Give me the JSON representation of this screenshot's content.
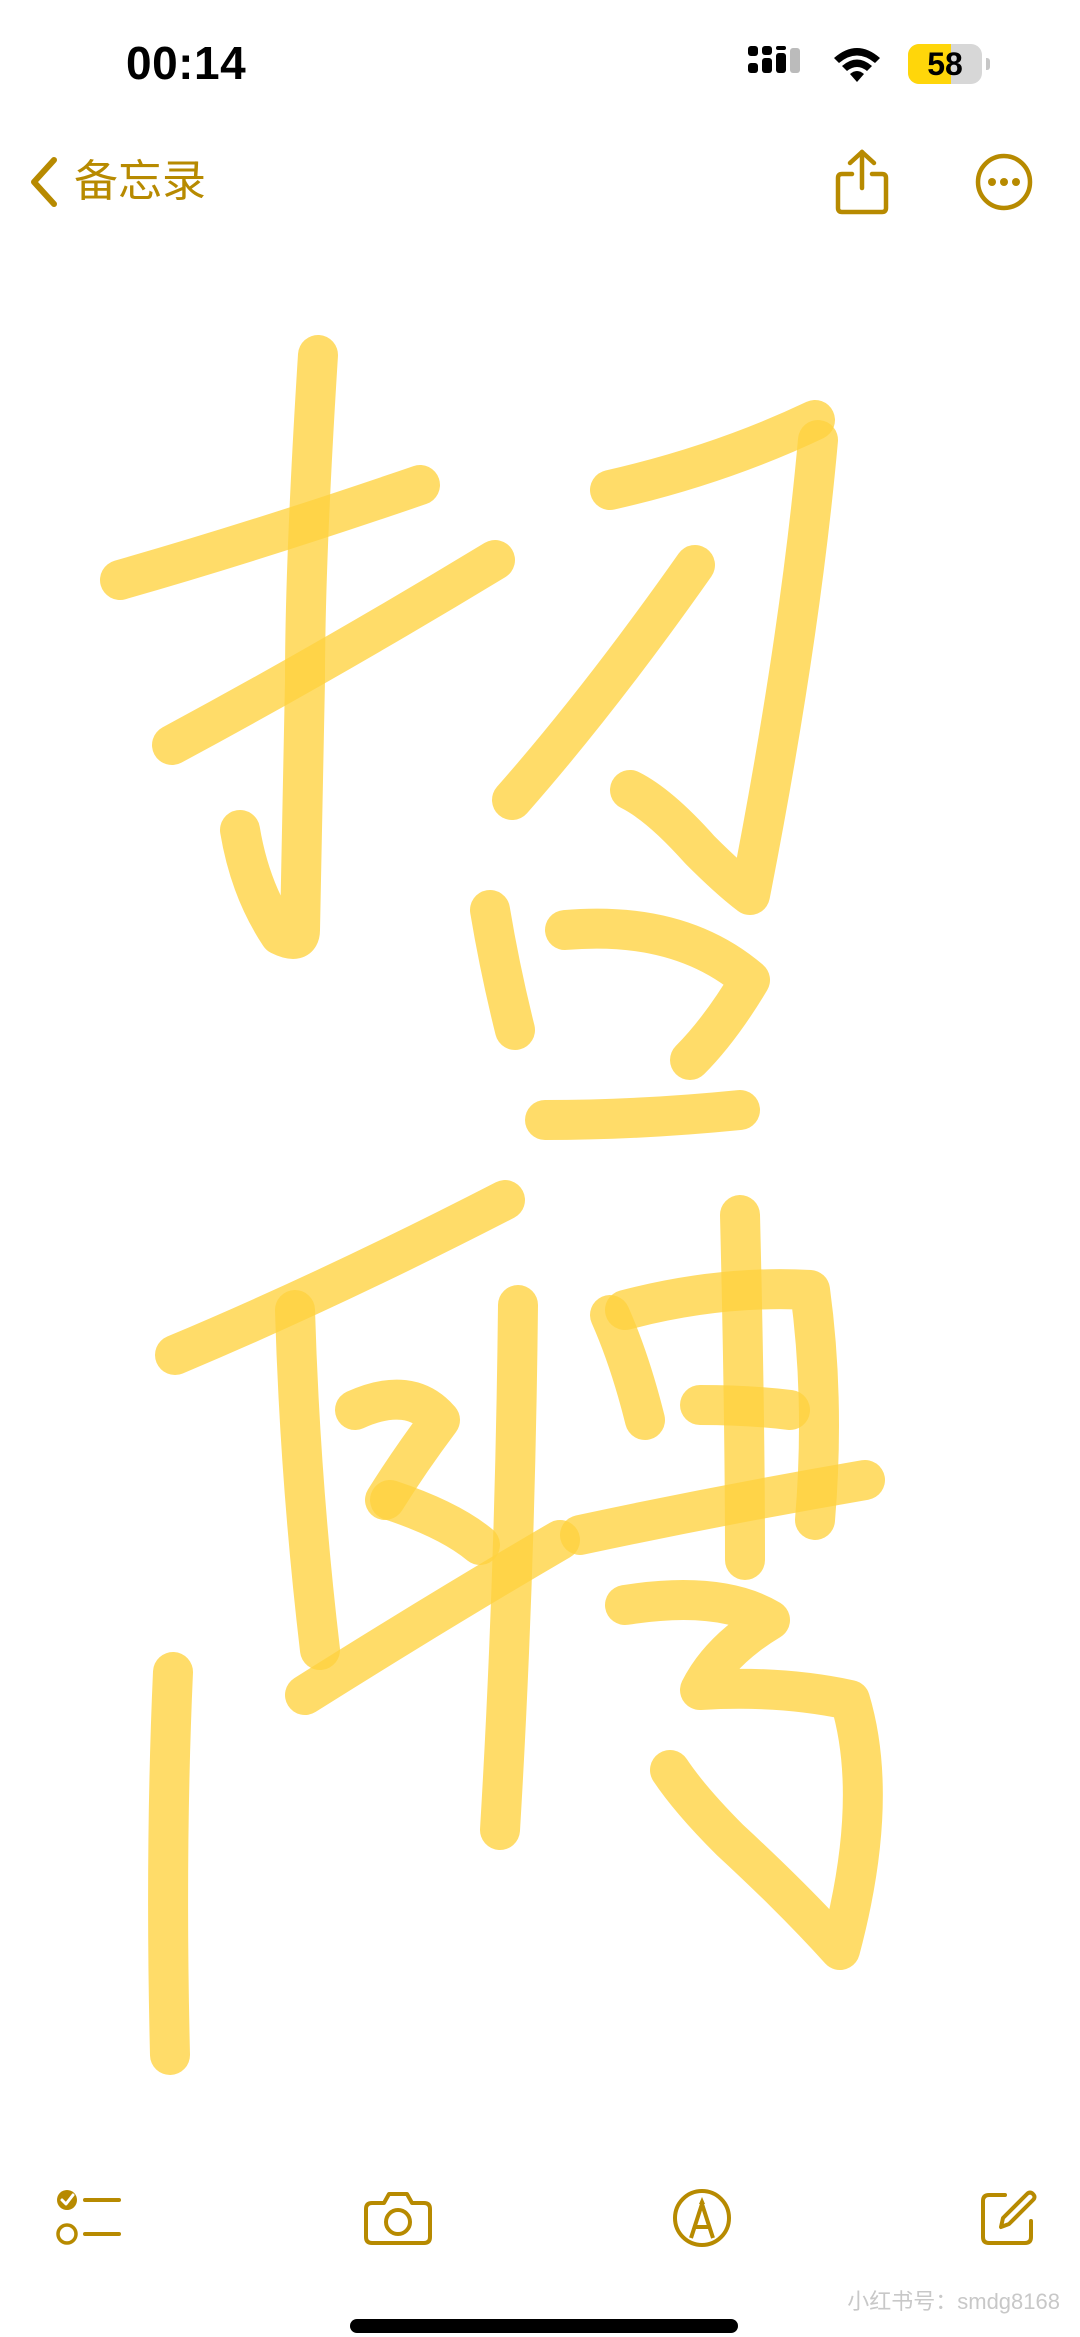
{
  "status_bar": {
    "time": "00:14",
    "battery_level": "58",
    "battery_fraction": 0.58
  },
  "nav": {
    "back_label": "备忘录",
    "share_icon": "share-icon",
    "more_icon": "ellipsis-circle-icon"
  },
  "note": {
    "drawing_color": "#ffd23f",
    "drawing_description_icon": "handwritten-drawing"
  },
  "toolbar": {
    "checklist_icon": "checklist-icon",
    "camera_icon": "camera-icon",
    "markup_icon": "markup-pen-icon",
    "compose_icon": "compose-icon"
  },
  "watermark": "小红书号：smdg8168",
  "colors": {
    "accent": "#b78a00",
    "battery": "#ffd60a",
    "background": "#ffffff"
  }
}
